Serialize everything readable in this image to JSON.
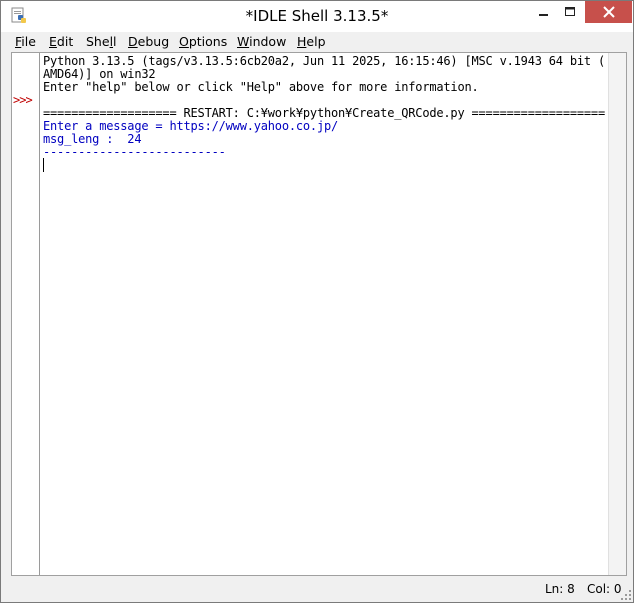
{
  "window": {
    "title": "*IDLE Shell 3.13.5*"
  },
  "menu": {
    "items": [
      {
        "label": "File",
        "underline": "F",
        "rest": "ile"
      },
      {
        "label": "Edit",
        "underline": "E",
        "rest": "dit"
      },
      {
        "label": "Shell",
        "pre": "She",
        "underline": "l",
        "rest": "l"
      },
      {
        "label": "Debug",
        "underline": "D",
        "rest": "ebug"
      },
      {
        "label": "Options",
        "underline": "O",
        "rest": "ptions"
      },
      {
        "label": "Window",
        "underline": "W",
        "rest": "indow"
      },
      {
        "label": "Help",
        "underline": "H",
        "rest": "elp"
      }
    ]
  },
  "shell": {
    "prompt": ">>>",
    "lines": [
      "Python 3.13.5 (tags/v3.13.5:6cb20a2, Jun 11 2025, 16:15:46) [MSC v.1943 64 bit (",
      "AMD64)] on win32",
      "Enter \"help\" below or click \"Help\" above for more information.",
      "",
      "=================== RESTART: C:¥work¥python¥Create_QRCode.py ===================",
      "Enter a message = https://www.yahoo.co.jp/",
      "msg_leng :  24",
      "--------------------------"
    ]
  },
  "status": {
    "line": "Ln: 8",
    "col": "Col: 0"
  },
  "icons": {
    "app": "idle-python-icon",
    "minimize": "minimize-icon",
    "maximize": "maximize-icon",
    "close": "close-icon",
    "grip": "resize-grip-icon"
  },
  "colors": {
    "output_blue": "#0000c0",
    "prompt_red": "#c00000",
    "close_button": "#c7504b"
  }
}
